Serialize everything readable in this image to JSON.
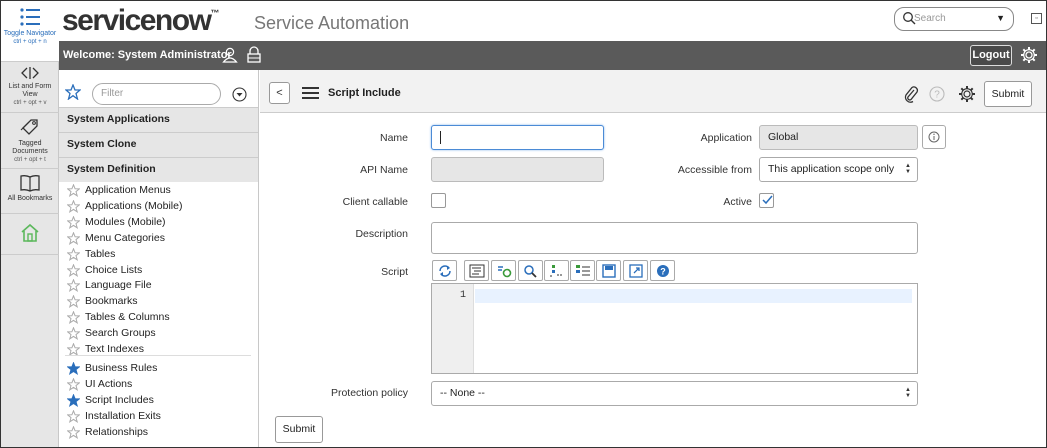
{
  "header": {
    "logo": "servicenow",
    "logo_mark": "™",
    "product": "Service Automation",
    "search_placeholder": "Search"
  },
  "bar": {
    "welcome": "Welcome:  System Administrator",
    "logout_label": "Logout"
  },
  "rail": [
    {
      "label": "Toggle Navigator",
      "shortcut": "ctrl + opt + n",
      "icon": "list-icon",
      "active": true
    },
    {
      "label": "List and Form View",
      "shortcut": "ctrl + opt + v",
      "icon": "split-view-icon",
      "active": false
    },
    {
      "label": "Tagged Documents",
      "shortcut": "ctrl + opt + t",
      "icon": "tag-icon",
      "active": false
    },
    {
      "label": "All Bookmarks",
      "shortcut": "",
      "icon": "book-icon",
      "active": false
    },
    {
      "label": "",
      "shortcut": "",
      "icon": "home-icon",
      "active": false
    }
  ],
  "nav": {
    "filter_placeholder": "Filter",
    "groups": [
      "System Applications",
      "System Clone",
      "System Definition"
    ],
    "items_a": [
      "Application Menus",
      "Applications (Mobile)",
      "Modules (Mobile)",
      "Menu Categories",
      "Tables",
      "Choice Lists",
      "Language File",
      "Bookmarks",
      "Tables & Columns",
      "Search Groups",
      "Text Indexes"
    ],
    "items_b": [
      {
        "label": "Business Rules",
        "starred": true
      },
      {
        "label": "UI Actions",
        "starred": false
      },
      {
        "label": "Script Includes",
        "starred": true
      },
      {
        "label": "Installation Exits",
        "starred": false
      },
      {
        "label": "Relationships",
        "starred": false
      }
    ]
  },
  "form": {
    "title": "Script Include",
    "submit_label": "Submit",
    "name_label": "Name",
    "name_value": "",
    "api_name_label": "API Name",
    "api_name_value": "",
    "client_callable_label": "Client callable",
    "client_callable_checked": false,
    "description_label": "Description",
    "description_value": "",
    "script_label": "Script",
    "script_line_no": "1",
    "application_label": "Application",
    "application_value": "Global",
    "accessible_label": "Accessible from",
    "accessible_value": "This application scope only",
    "active_label": "Active",
    "active_checked": true,
    "protection_label": "Protection policy",
    "protection_value": "-- None --"
  },
  "colors": {
    "accent": "#2a6ebb",
    "darkbar": "#5a5a5a",
    "home": "#5cb85c",
    "logo_green": "#81b5a1"
  }
}
